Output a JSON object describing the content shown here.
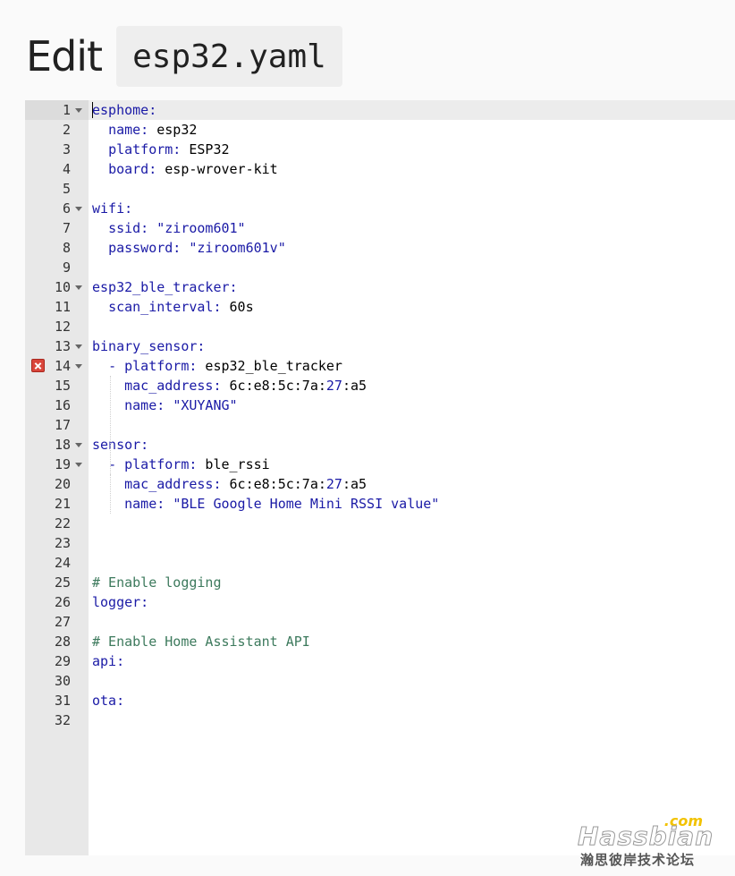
{
  "header": {
    "title": "Edit",
    "filename": "esp32.yaml"
  },
  "editor": {
    "lines": [
      {
        "n": "1",
        "fold": true,
        "html": "<span class='k'>esphome:</span>"
      },
      {
        "n": "2",
        "html": "  <span class='k'>name:</span> esp32"
      },
      {
        "n": "3",
        "html": "  <span class='k'>platform:</span> ESP32"
      },
      {
        "n": "4",
        "html": "  <span class='k'>board:</span> esp-wrover-kit"
      },
      {
        "n": "5",
        "html": ""
      },
      {
        "n": "6",
        "fold": true,
        "html": "<span class='k'>wifi:</span>"
      },
      {
        "n": "7",
        "html": "  <span class='k'>ssid:</span> <span class='s'>\"ziroom601\"</span>"
      },
      {
        "n": "8",
        "html": "  <span class='k'>password:</span> <span class='s'>\"ziroom601v\"</span>"
      },
      {
        "n": "9",
        "html": ""
      },
      {
        "n": "10",
        "fold": true,
        "html": "<span class='k'>esp32_ble_tracker:</span>"
      },
      {
        "n": "11",
        "html": "  <span class='k'>scan_interval:</span> 60s"
      },
      {
        "n": "12",
        "html": ""
      },
      {
        "n": "13",
        "fold": true,
        "html": "<span class='k'>binary_sensor:</span>"
      },
      {
        "n": "14",
        "fold": true,
        "error": true,
        "html": "  <span class='k'>- platform:</span> esp32_ble_tracker"
      },
      {
        "n": "15",
        "html": "    <span class='k'>mac_address:</span> 6c:e8:5c:7a:<span class='n'>27</span>:a5"
      },
      {
        "n": "16",
        "html": "    <span class='k'>name:</span> <span class='s'>\"XUYANG\"</span>"
      },
      {
        "n": "17",
        "html": ""
      },
      {
        "n": "18",
        "fold": true,
        "html": "<span class='k'>sensor:</span>"
      },
      {
        "n": "19",
        "fold": true,
        "html": "  <span class='k'>- platform:</span> ble_rssi"
      },
      {
        "n": "20",
        "html": "    <span class='k'>mac_address:</span> 6c:e8:5c:7a:<span class='n'>27</span>:a5"
      },
      {
        "n": "21",
        "html": "    <span class='k'>name:</span> <span class='s'>\"BLE Google Home Mini RSSI value\"</span>"
      },
      {
        "n": "22",
        "html": ""
      },
      {
        "n": "23",
        "html": ""
      },
      {
        "n": "24",
        "html": ""
      },
      {
        "n": "25",
        "html": "<span class='c'># Enable logging</span>"
      },
      {
        "n": "26",
        "html": "<span class='k'>logger:</span>"
      },
      {
        "n": "27",
        "html": ""
      },
      {
        "n": "28",
        "html": "<span class='c'># Enable Home Assistant API</span>"
      },
      {
        "n": "29",
        "html": "<span class='k'>api:</span>"
      },
      {
        "n": "30",
        "html": ""
      },
      {
        "n": "31",
        "html": "<span class='k'>ota:</span>"
      },
      {
        "n": "32",
        "html": ""
      }
    ]
  },
  "watermark": {
    "com": ".com",
    "logo": "Hassbian",
    "sub": "瀚思彼岸技术论坛"
  },
  "colors": {
    "key": "#1a1aa6",
    "comment": "#3d7a5d",
    "error": "#d9453b"
  },
  "icons": {
    "fold": "triangle-down-icon",
    "error": "error-x-icon"
  }
}
